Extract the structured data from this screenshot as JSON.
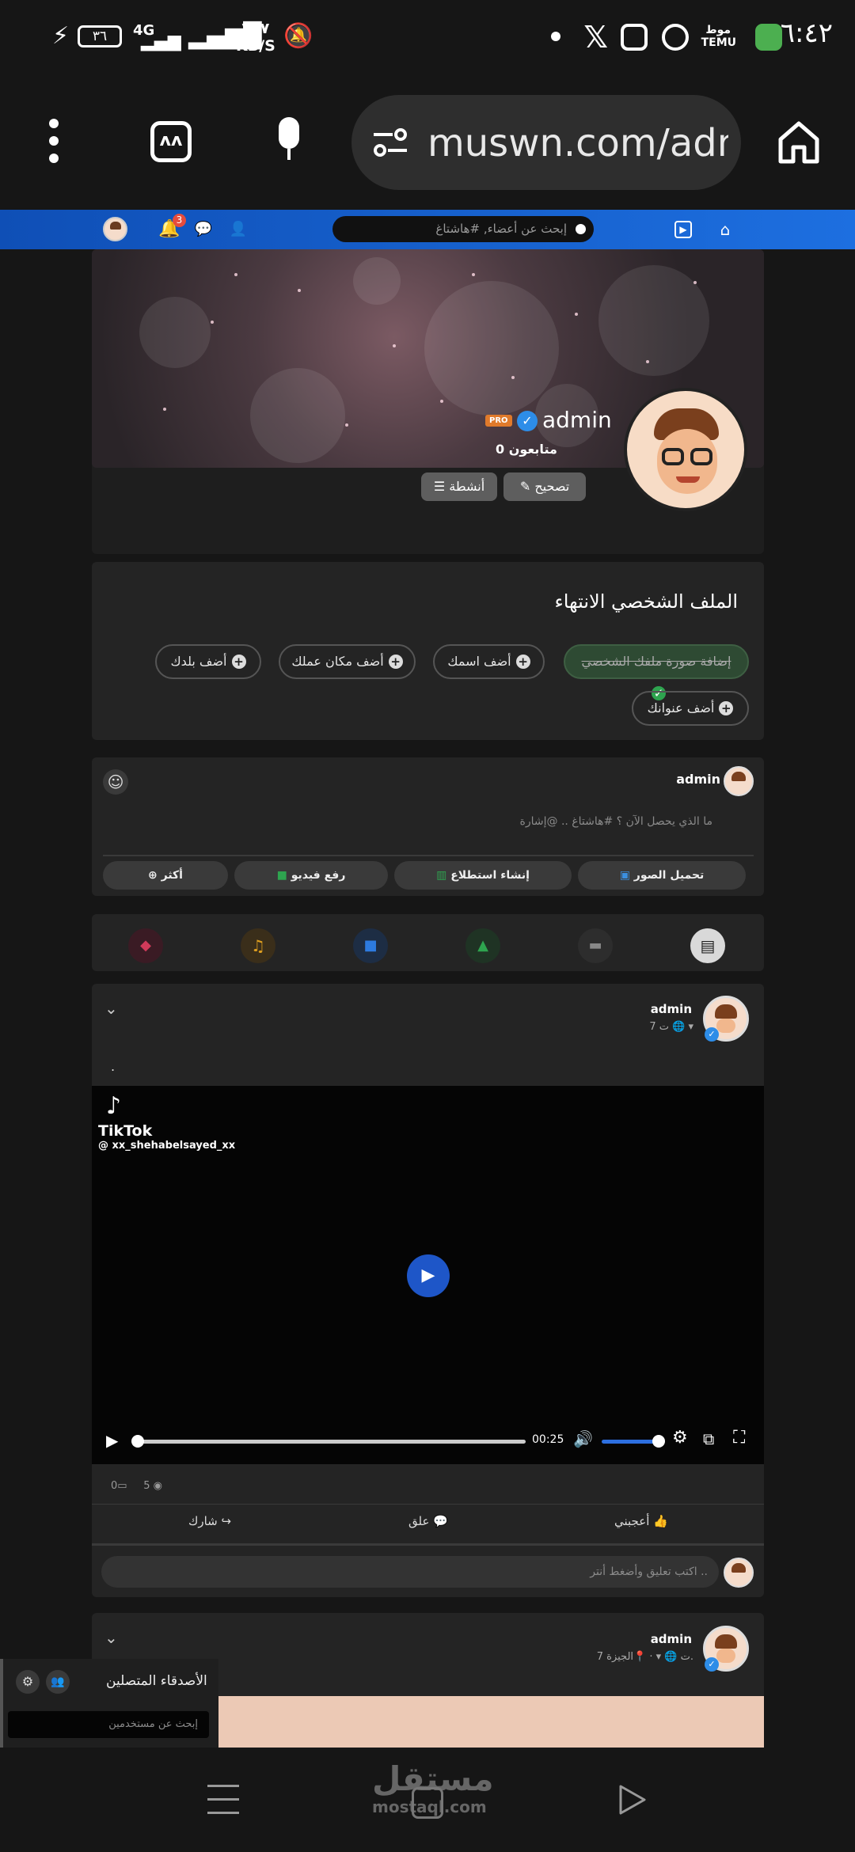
{
  "status_bar": {
    "time": "٦:٤٢",
    "network_speed_value": "٣٢٧",
    "network_speed_unit": "KB/S",
    "signal_label": "4G",
    "battery": "٣٦",
    "temu_label": "TEMU"
  },
  "browser": {
    "url": "muswn.com/adm"
  },
  "site_header": {
    "search_placeholder": "إبحث عن أعضاء, #هاشتاغ",
    "notification_count": "3"
  },
  "profile": {
    "name": "admin",
    "pro_badge": "PRO",
    "followers": "0 متابعون",
    "edit_label": "تصحيح",
    "activities_label": "أنشطة"
  },
  "completion": {
    "title": "الملف الشخصي الانتهاء",
    "items": [
      {
        "label": "إضافة صورة ملفك الشخصي",
        "done": true
      },
      {
        "label": "أضف اسمك",
        "done": false
      },
      {
        "label": "أضف مكان عملك",
        "done": false
      },
      {
        "label": "أضف بلدك",
        "done": false
      },
      {
        "label": "أضف عنوانك",
        "done": false
      }
    ]
  },
  "composer": {
    "user": "admin",
    "placeholder": "ما الذي يحصل الآن ؟ #هاشتاغ .. @إشارة",
    "actions": [
      "تحميل الصور",
      "إنشاء استطلاع",
      "رفع فيديو",
      "أكثر"
    ]
  },
  "post1": {
    "author": "admin",
    "meta": "7 ت",
    "body": ".",
    "tiktok_brand": "TikTok",
    "tiktok_user": "@ xx_shehabelsayed_xx",
    "video_time": "00:25",
    "comments_count": "0",
    "views_count": "5",
    "like_label": "أعجبني",
    "comment_label": "علق",
    "share_label": "شارك",
    "comment_placeholder": "اكتب تعليق وأضغط أنتر .."
  },
  "post2": {
    "author": "admin",
    "meta": "7 ت",
    "location": "الجيزة."
  },
  "friends_panel": {
    "title": "الأصدقاء المتصلين",
    "search_placeholder": "إبحث عن مستخدمين"
  },
  "watermark": {
    "arabic": "مستقل",
    "latin": "mostaql.com"
  },
  "colors": {
    "header_blue": "#1565d8",
    "play_blue": "#1e56c8",
    "success_green": "#2ea44f",
    "pro_orange": "#e07a2b"
  }
}
